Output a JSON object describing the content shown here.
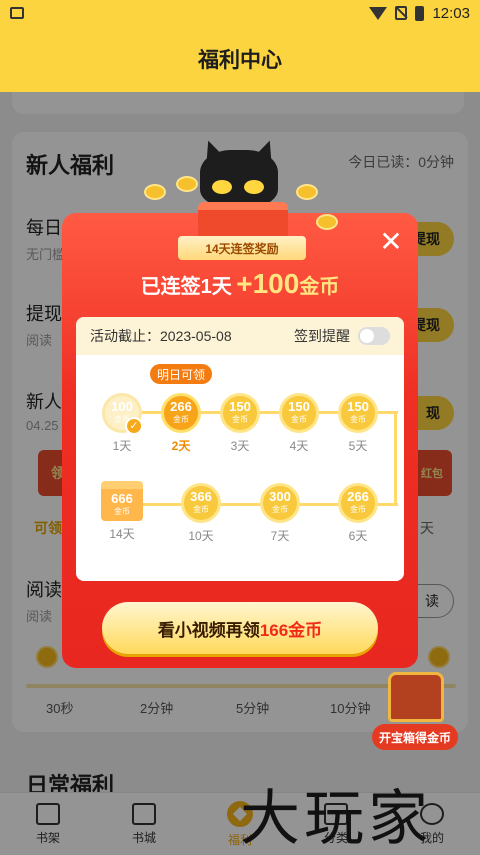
{
  "status_bar": {
    "time": "12:03"
  },
  "header": {
    "title": "福利中心"
  },
  "background": {
    "section_title": "新人福利",
    "today_read": "今日已读：0分钟",
    "rows": [
      {
        "title": "每日",
        "sub": "无门槛",
        "button": "提现"
      },
      {
        "title": "提现",
        "sub": "阅读",
        "button": "提现"
      },
      {
        "title": "新人",
        "sub": "04.25",
        "button": "现"
      }
    ],
    "red_box_left": "领",
    "red_box_right": "红包",
    "label_left": "可领",
    "label_right": "天",
    "reading_title": "阅读",
    "reading_sub": "阅读",
    "reading_button": "读",
    "progress_ticks": [
      "30秒",
      "2分钟",
      "5分钟",
      "10分钟"
    ],
    "treasure_label": "开宝箱得金币",
    "daily_title": "日常福利"
  },
  "modal": {
    "ribbon": "14天连签奖励",
    "streak_prefix": "已连签1天",
    "streak_amount": "+100",
    "streak_unit": "金币",
    "deadline": "活动截止：2023-05-08",
    "reminder": "签到提醒",
    "tomorrow_tag": "明日可领",
    "coin_unit": "金币",
    "days_top": [
      {
        "value": "100",
        "label": "1天",
        "state": "done"
      },
      {
        "value": "266",
        "label": "2天",
        "state": "next"
      },
      {
        "value": "150",
        "label": "3天",
        "state": "normal"
      },
      {
        "value": "150",
        "label": "4天",
        "state": "normal"
      },
      {
        "value": "150",
        "label": "5天",
        "state": "normal"
      }
    ],
    "days_bottom": [
      {
        "value": "666",
        "label": "14天",
        "state": "gift"
      },
      {
        "value": "366",
        "label": "10天",
        "state": "normal"
      },
      {
        "value": "300",
        "label": "7天",
        "state": "normal"
      },
      {
        "value": "266",
        "label": "6天",
        "state": "normal"
      }
    ],
    "video_prefix": "看小视频再领",
    "video_amount": "166金币"
  },
  "bottom_nav": {
    "items": [
      "书架",
      "书城",
      "福利",
      "分类",
      "我的"
    ]
  },
  "watermark": "大玩家"
}
